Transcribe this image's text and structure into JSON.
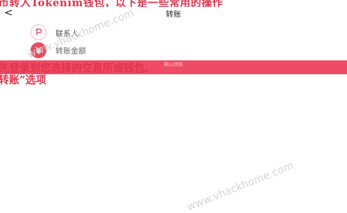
{
  "top_overlay_text": "币转入Tokenim钱包，以下是一些常用的操作",
  "nav": {
    "back_icon": "chevron-left-icon",
    "back_glyph": "<",
    "title": "转账"
  },
  "list": {
    "items": [
      {
        "label": "联系人",
        "icon": "contact-icon",
        "icon_glyph": "P"
      },
      {
        "label": "转账金额",
        "icon": "yuan-currency-icon",
        "icon_glyph": "¥"
      }
    ]
  },
  "band_caption": "确认转账",
  "overlay_lines": [
    "先登录到您选择的交易所或钱包。",
    "转账”选项"
  ],
  "watermark": "www.vhackhome.com",
  "colors": {
    "accent": "#f04b64",
    "overlay_text": "#e0344c"
  }
}
